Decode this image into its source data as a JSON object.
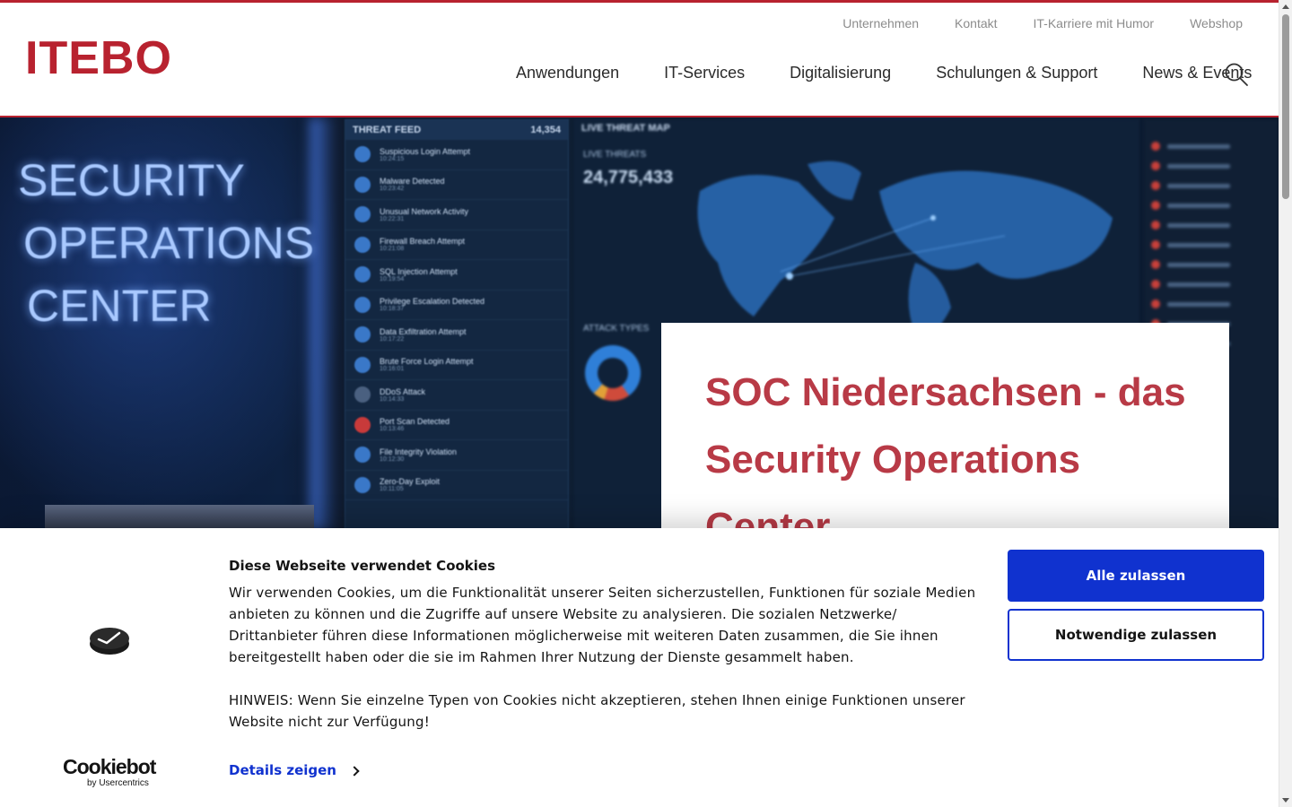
{
  "brand": {
    "logo_text": "ITEBO",
    "accent": "#b8222f",
    "headline_color": "#b83a46"
  },
  "meta_nav": [
    {
      "label": "Unternehmen"
    },
    {
      "label": "Kontakt"
    },
    {
      "label": "IT-Karriere mit Humor"
    },
    {
      "label": "Webshop"
    }
  ],
  "main_nav": [
    {
      "label": "Anwendungen"
    },
    {
      "label": "IT-Services"
    },
    {
      "label": "Digitalisierung"
    },
    {
      "label": "Schulungen & Support"
    },
    {
      "label": "News & Events"
    }
  ],
  "search": {
    "icon": "search-icon"
  },
  "hero": {
    "image_text": {
      "lines": [
        "SECURITY",
        "OPERATIONS",
        "CENTER"
      ],
      "feed_title": "THREAT FEED",
      "feed_count": "14,354",
      "feed_items": [
        {
          "title": "Suspicious Login Attempt",
          "time": "10:24:15"
        },
        {
          "title": "Malware Detected",
          "time": "10:23:42"
        },
        {
          "title": "Unusual Network Activity",
          "time": "10:22:31"
        },
        {
          "title": "Firewall Breach Attempt",
          "time": "10:21:08"
        },
        {
          "title": "SQL Injection Attempt",
          "time": "10:19:54"
        },
        {
          "title": "Privilege Escalation Detected",
          "time": "10:18:37"
        },
        {
          "title": "Data Exfiltration Attempt",
          "time": "10:17:22"
        },
        {
          "title": "Brute Force Login Attempt",
          "time": "10:16:01"
        },
        {
          "title": "DDoS Attack",
          "time": "10:14:33"
        },
        {
          "title": "Port Scan Detected",
          "time": "10:13:46"
        },
        {
          "title": "File Integrity Violation",
          "time": "10:12:30"
        },
        {
          "title": "Zero-Day Exploit",
          "time": "10:11:05"
        }
      ],
      "map_title": "LIVE THREAT MAP",
      "live_threats_label": "LIVE THREATS",
      "live_threats_value": "24,775,433",
      "attack_types_label": "ATTACK TYPES"
    },
    "heading": "SOC Niedersachsen - das Security Operations Center"
  },
  "cookie_banner": {
    "title": "Diese Webseite verwendet Cookies",
    "text": "Wir verwenden Cookies, um die Funktionalität unserer Seiten sicherzustellen, Funktionen für soziale Medien anbieten zu können und die Zugriffe auf unsere Website zu analysieren. Die sozialen Netzwerke/ Drittanbieter führen diese Informationen möglicherweise mit weiteren Daten zusammen, die Sie ihnen bereitgestellt haben oder die sie im Rahmen Ihrer Nutzung der Dienste gesammelt haben.",
    "hint": "HINWEIS: Wenn Sie einzelne Typen von Cookies nicht akzeptieren, stehen Ihnen einige Funktionen unserer Website nicht zur Verfügung!",
    "details_label": "Details zeigen",
    "allow_all_label": "Alle zulassen",
    "allow_necessary_label": "Notwendige zulassen",
    "brand_name": "Cookiebot",
    "brand_by": "by Usercentrics",
    "button_color": "#1032cf"
  }
}
